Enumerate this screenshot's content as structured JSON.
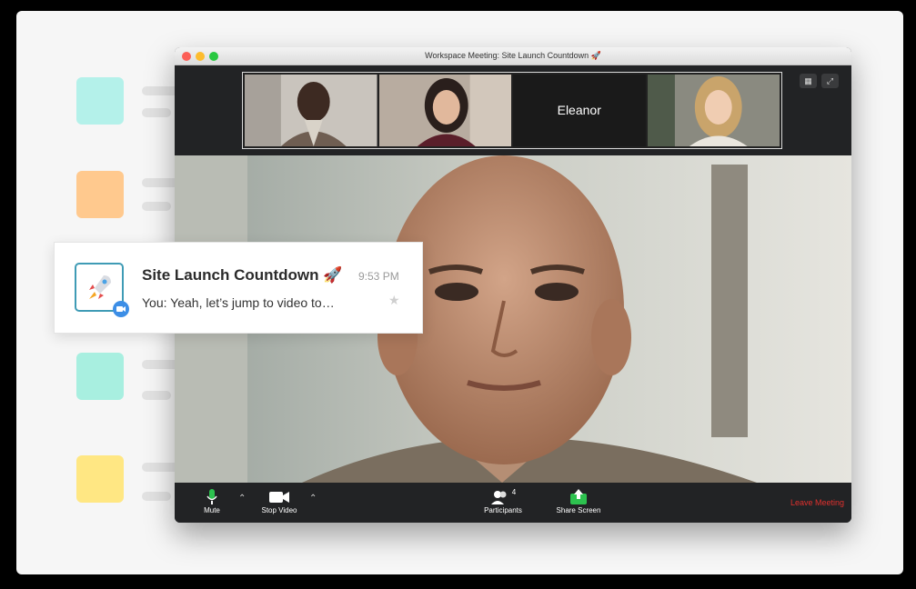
{
  "window": {
    "title": "Workspace Meeting: Site Launch Countdown 🚀",
    "dots": [
      "#fc5f57",
      "#fdbc2e",
      "#28c840"
    ]
  },
  "channels": [
    {
      "color": "#b4f1ea"
    },
    {
      "color": "#ffc98e"
    },
    {
      "color": "#a8efe0"
    },
    {
      "color": "#ffe783"
    }
  ],
  "gallery": {
    "participants": [
      {
        "name": "",
        "icon": "participant-1-photo"
      },
      {
        "name": "",
        "icon": "participant-2-photo"
      },
      {
        "name": "Eleanor",
        "icon": "participant-eleanor-placeholder"
      },
      {
        "name": "",
        "icon": "participant-4-photo"
      }
    ]
  },
  "toolbar": {
    "mute_label": "Mute",
    "stop_video_label": "Stop Video",
    "participants_label": "Participants",
    "participants_count": "4",
    "share_screen_label": "Share Screen",
    "leave_label": "Leave Meeting"
  },
  "chat_card": {
    "title": "Site Launch Countdown 🚀",
    "time": "9:53 PM",
    "message": "You: Yeah, let’s jump to video to…",
    "icon": "rocket-icon"
  },
  "colors": {
    "accent": "#3f9bb5",
    "share_green": "#2dc24f",
    "leave_red": "#e0302d",
    "video_badge": "#3c8ee6"
  }
}
